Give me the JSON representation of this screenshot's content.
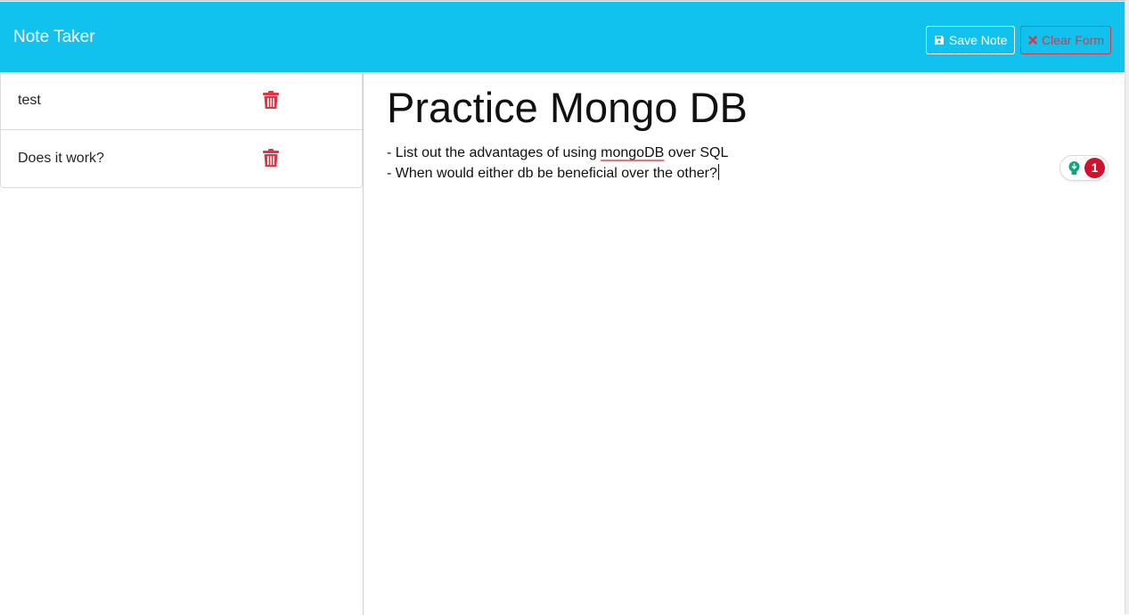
{
  "app": {
    "title": "Note Taker"
  },
  "toolbar": {
    "save_label": "Save Note",
    "save_icon": "floppy-disk-icon",
    "clear_label": "Clear Form",
    "clear_icon": "x-icon"
  },
  "notes": [
    {
      "title": "test",
      "delete_icon": "trash-icon"
    },
    {
      "title": "Does it work?",
      "delete_icon": "trash-icon"
    }
  ],
  "active_note": {
    "title": "Practice Mongo DB",
    "body": {
      "line1_prefix": "- List out the advantages of using ",
      "line1_flagged": "mongoDB",
      "line1_suffix": " over SQL",
      "line2": "- When would either db be beneficial over the other?"
    }
  },
  "grammar_widget": {
    "issue_count": "1",
    "icon": "lightbulb-icon"
  },
  "colors": {
    "navbar": "#12c2ee",
    "danger": "#dc3545",
    "badge": "#d0122e",
    "bulb": "#15a37f"
  }
}
